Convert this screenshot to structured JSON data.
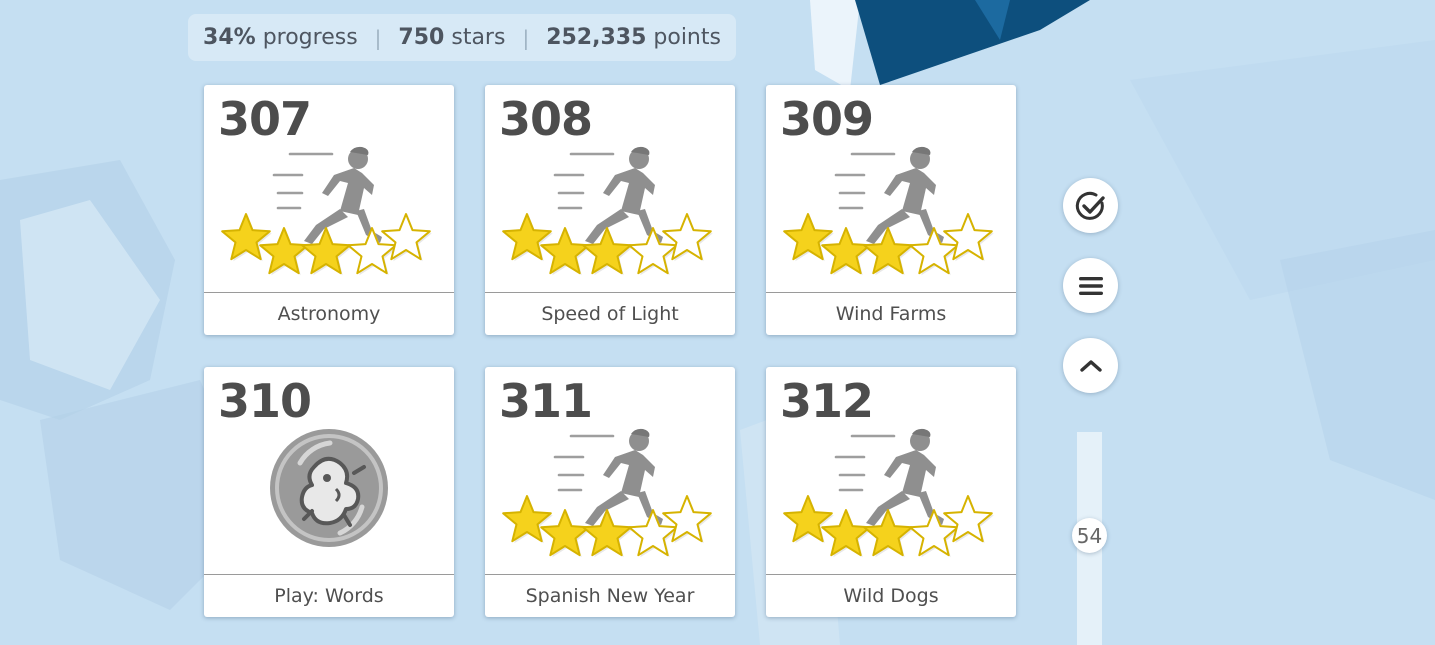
{
  "stats": {
    "progress_value": "34%",
    "progress_label": "progress",
    "stars_value": "750",
    "stars_label": "stars",
    "points_value": "252,335",
    "points_label": "points",
    "separator": "|"
  },
  "lessons": [
    {
      "number": "307",
      "title": "Astronomy",
      "icon": "runner-stars-icon",
      "stars_earned": 3,
      "stars_total": 5
    },
    {
      "number": "308",
      "title": "Speed of Light",
      "icon": "runner-stars-icon",
      "stars_earned": 3,
      "stars_total": 5
    },
    {
      "number": "309",
      "title": "Wind Farms",
      "icon": "runner-stars-icon",
      "stars_earned": 3,
      "stars_total": 5
    },
    {
      "number": "310",
      "title": "Play: Words",
      "icon": "game-medal-icon"
    },
    {
      "number": "311",
      "title": "Spanish New Year",
      "icon": "runner-stars-icon",
      "stars_earned": 3,
      "stars_total": 5
    },
    {
      "number": "312",
      "title": "Wild Dogs",
      "icon": "runner-stars-icon",
      "stars_earned": 3,
      "stars_total": 5
    }
  ],
  "side_buttons": {
    "check_icon": "check-circle-icon",
    "menu_icon": "hamburger-menu-icon",
    "up_icon": "chevron-up-icon"
  },
  "scroll_indicator": {
    "value": "54"
  },
  "colors": {
    "background": "#c5dff2",
    "star_fill": "#f5d21c",
    "star_outline": "#d6b300",
    "dark_shape": "#0d4f7d"
  }
}
